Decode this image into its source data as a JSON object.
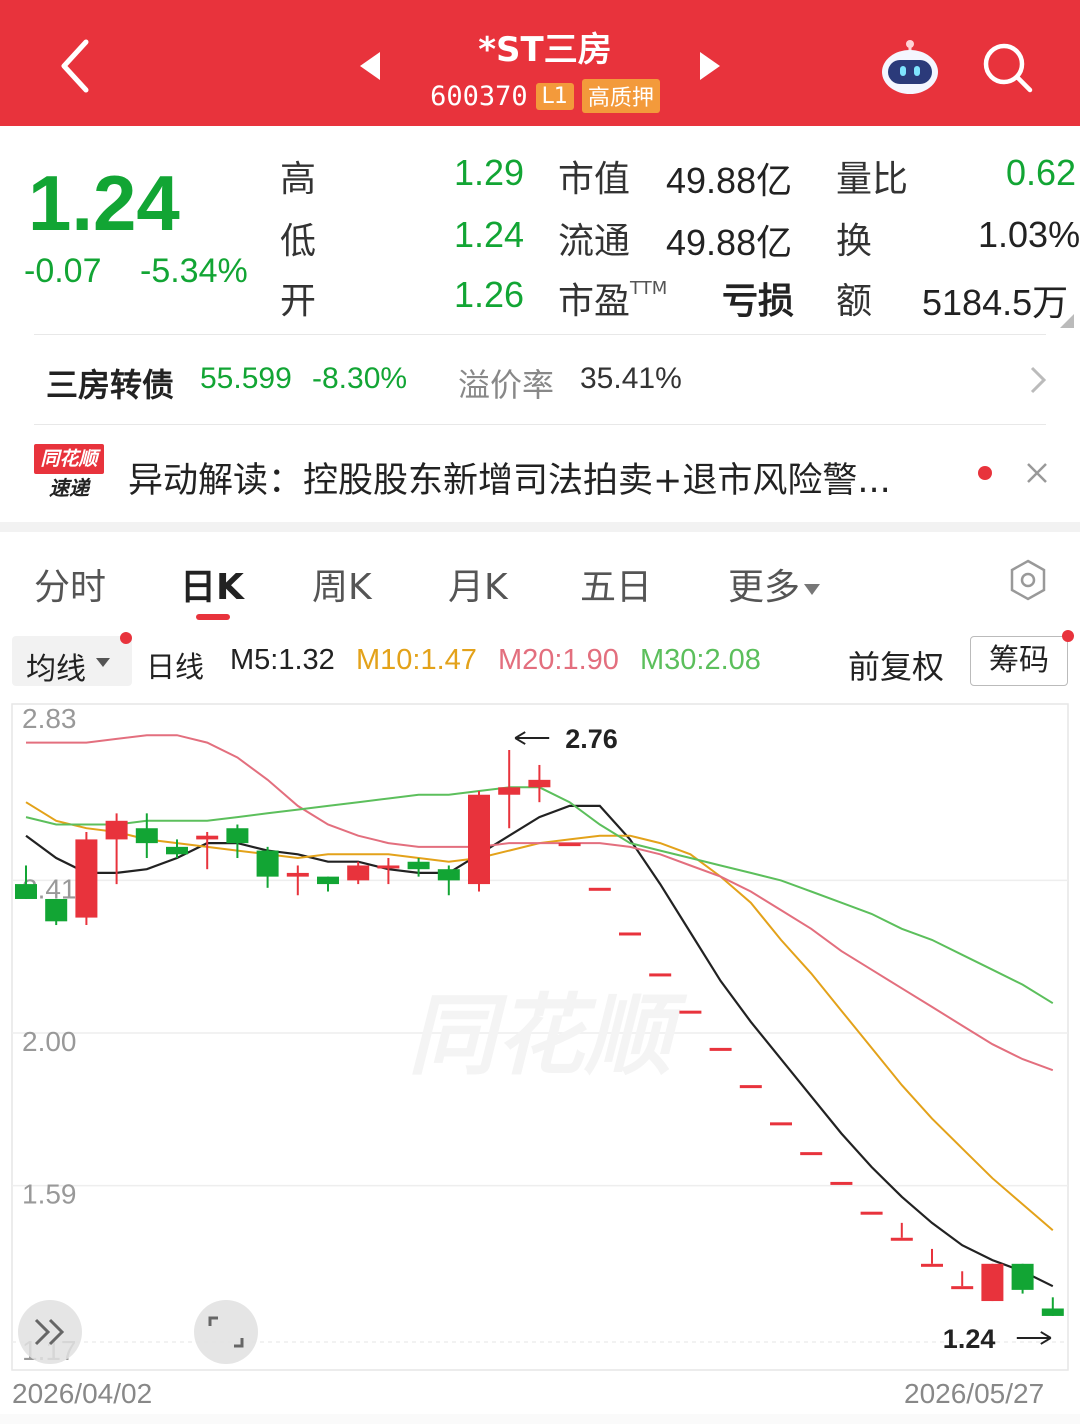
{
  "header": {
    "title": "*ST三房",
    "code": "600370",
    "level_tag": "L1",
    "pledge_tag": "高质押"
  },
  "quote": {
    "price": "1.24",
    "change": "-0.07",
    "change_pct": "-5.34%",
    "rows": [
      {
        "l1": "高",
        "v1": "1.29",
        "l2": "市值",
        "v2": "49.88亿",
        "l3": "量比",
        "v3": "0.62"
      },
      {
        "l1": "低",
        "v1": "1.24",
        "l2": "流通",
        "v2": "49.88亿",
        "l3": "换",
        "v3": "1.03%"
      },
      {
        "l1": "开",
        "v1": "1.26",
        "l2": "市盈",
        "l2_sup": "TTM",
        "v2": "亏损",
        "l3": "额",
        "v3": "5184.5万"
      }
    ]
  },
  "bond": {
    "name": "三房转债",
    "price": "55.599",
    "change_pct": "-8.30%",
    "premium_label": "溢价率",
    "premium_value": "35.41%"
  },
  "news": {
    "logo_top": "同花顺",
    "logo_bottom": "速递",
    "text": "异动解读：控股股东新增司法拍卖+退市风险警..."
  },
  "tabs": [
    {
      "label": "分时"
    },
    {
      "label": "日K"
    },
    {
      "label": "周K"
    },
    {
      "label": "月K"
    },
    {
      "label": "五日"
    },
    {
      "label": "更多"
    }
  ],
  "indicators": {
    "ma_select": "均线",
    "period": "日线",
    "m5": "M5:1.32",
    "m10": "M10:1.47",
    "m20": "M20:1.90",
    "m30": "M30:2.08",
    "adjust": "前复权",
    "chip": "筹码"
  },
  "colors": {
    "header_bg": "#e8333c",
    "down": "#12a534",
    "up": "#e8333c",
    "m5": "#222222",
    "m10": "#e3a21a",
    "m20": "#e36f7e",
    "m30": "#5cbf5c"
  },
  "chart_data": {
    "type": "candlestick",
    "y_ticks": [
      "2.83",
      "2.41",
      "2.00",
      "1.59",
      "1.17"
    ],
    "ylim": [
      1.17,
      2.83
    ],
    "high_label": "2.76",
    "low_label": "1.24",
    "x_start": "2026/04/02",
    "x_end": "2026/05/27",
    "watermark": "同花顺",
    "candles": [
      {
        "o": 2.4,
        "h": 2.45,
        "l": 2.36,
        "c": 2.36
      },
      {
        "o": 2.36,
        "h": 2.36,
        "l": 2.29,
        "c": 2.3
      },
      {
        "o": 2.31,
        "h": 2.54,
        "l": 2.29,
        "c": 2.52
      },
      {
        "o": 2.52,
        "h": 2.59,
        "l": 2.4,
        "c": 2.57
      },
      {
        "o": 2.55,
        "h": 2.59,
        "l": 2.47,
        "c": 2.51
      },
      {
        "o": 2.5,
        "h": 2.52,
        "l": 2.47,
        "c": 2.48
      },
      {
        "o": 2.52,
        "h": 2.54,
        "l": 2.44,
        "c": 2.53
      },
      {
        "o": 2.55,
        "h": 2.56,
        "l": 2.47,
        "c": 2.51
      },
      {
        "o": 2.49,
        "h": 2.5,
        "l": 2.39,
        "c": 2.42
      },
      {
        "o": 2.42,
        "h": 2.45,
        "l": 2.37,
        "c": 2.43
      },
      {
        "o": 2.42,
        "h": 2.42,
        "l": 2.38,
        "c": 2.4
      },
      {
        "o": 2.41,
        "h": 2.46,
        "l": 2.4,
        "c": 2.45
      },
      {
        "o": 2.45,
        "h": 2.47,
        "l": 2.4,
        "c": 2.45
      },
      {
        "o": 2.46,
        "h": 2.47,
        "l": 2.42,
        "c": 2.44
      },
      {
        "o": 2.44,
        "h": 2.45,
        "l": 2.37,
        "c": 2.41
      },
      {
        "o": 2.4,
        "h": 2.65,
        "l": 2.38,
        "c": 2.64
      },
      {
        "o": 2.64,
        "h": 2.76,
        "l": 2.55,
        "c": 2.66
      },
      {
        "o": 2.66,
        "h": 2.72,
        "l": 2.62,
        "c": 2.68
      },
      {
        "o": 2.51,
        "h": 2.51,
        "l": 2.51,
        "c": 2.51
      },
      {
        "o": 2.39,
        "h": 2.39,
        "l": 2.39,
        "c": 2.39
      },
      {
        "o": 2.27,
        "h": 2.27,
        "l": 2.27,
        "c": 2.27
      },
      {
        "o": 2.16,
        "h": 2.16,
        "l": 2.16,
        "c": 2.16
      },
      {
        "o": 2.06,
        "h": 2.06,
        "l": 2.06,
        "c": 2.06
      },
      {
        "o": 1.96,
        "h": 1.96,
        "l": 1.96,
        "c": 1.96
      },
      {
        "o": 1.86,
        "h": 1.86,
        "l": 1.86,
        "c": 1.86
      },
      {
        "o": 1.76,
        "h": 1.76,
        "l": 1.76,
        "c": 1.76
      },
      {
        "o": 1.68,
        "h": 1.68,
        "l": 1.68,
        "c": 1.68
      },
      {
        "o": 1.6,
        "h": 1.6,
        "l": 1.6,
        "c": 1.6
      },
      {
        "o": 1.52,
        "h": 1.52,
        "l": 1.52,
        "c": 1.52
      },
      {
        "o": 1.45,
        "h": 1.49,
        "l": 1.45,
        "c": 1.45
      },
      {
        "o": 1.38,
        "h": 1.42,
        "l": 1.38,
        "c": 1.38
      },
      {
        "o": 1.32,
        "h": 1.36,
        "l": 1.32,
        "c": 1.32
      },
      {
        "o": 1.28,
        "h": 1.38,
        "l": 1.28,
        "c": 1.38
      },
      {
        "o": 1.38,
        "h": 1.38,
        "l": 1.3,
        "c": 1.31
      },
      {
        "o": 1.26,
        "h": 1.29,
        "l": 1.24,
        "c": 1.24
      }
    ],
    "series": [
      {
        "name": "M5",
        "values": [
          2.53,
          2.47,
          2.43,
          2.43,
          2.44,
          2.47,
          2.51,
          2.51,
          2.49,
          2.48,
          2.46,
          2.46,
          2.44,
          2.43,
          2.43,
          2.48,
          2.53,
          2.58,
          2.61,
          2.61,
          2.52,
          2.4,
          2.27,
          2.14,
          2.03,
          1.93,
          1.83,
          1.73,
          1.64,
          1.56,
          1.49,
          1.43,
          1.39,
          1.36,
          1.32
        ]
      },
      {
        "name": "M10",
        "values": [
          2.62,
          2.57,
          2.55,
          2.54,
          2.52,
          2.51,
          2.5,
          2.49,
          2.48,
          2.47,
          2.48,
          2.48,
          2.48,
          2.47,
          2.46,
          2.47,
          2.49,
          2.51,
          2.52,
          2.53,
          2.53,
          2.51,
          2.48,
          2.42,
          2.35,
          2.25,
          2.16,
          2.06,
          1.96,
          1.86,
          1.77,
          1.69,
          1.61,
          1.54,
          1.47
        ]
      },
      {
        "name": "M20",
        "values": [
          2.78,
          2.78,
          2.78,
          2.79,
          2.8,
          2.8,
          2.78,
          2.74,
          2.68,
          2.61,
          2.56,
          2.53,
          2.51,
          2.5,
          2.5,
          2.5,
          2.51,
          2.51,
          2.51,
          2.51,
          2.5,
          2.48,
          2.45,
          2.42,
          2.38,
          2.33,
          2.28,
          2.22,
          2.17,
          2.12,
          2.07,
          2.02,
          1.97,
          1.93,
          1.9
        ]
      },
      {
        "name": "M30",
        "values": [
          2.58,
          2.56,
          2.56,
          2.56,
          2.57,
          2.57,
          2.57,
          2.58,
          2.59,
          2.6,
          2.61,
          2.62,
          2.63,
          2.64,
          2.64,
          2.65,
          2.66,
          2.66,
          2.62,
          2.56,
          2.51,
          2.49,
          2.47,
          2.45,
          2.43,
          2.41,
          2.38,
          2.35,
          2.32,
          2.28,
          2.25,
          2.21,
          2.17,
          2.13,
          2.08
        ]
      }
    ]
  }
}
